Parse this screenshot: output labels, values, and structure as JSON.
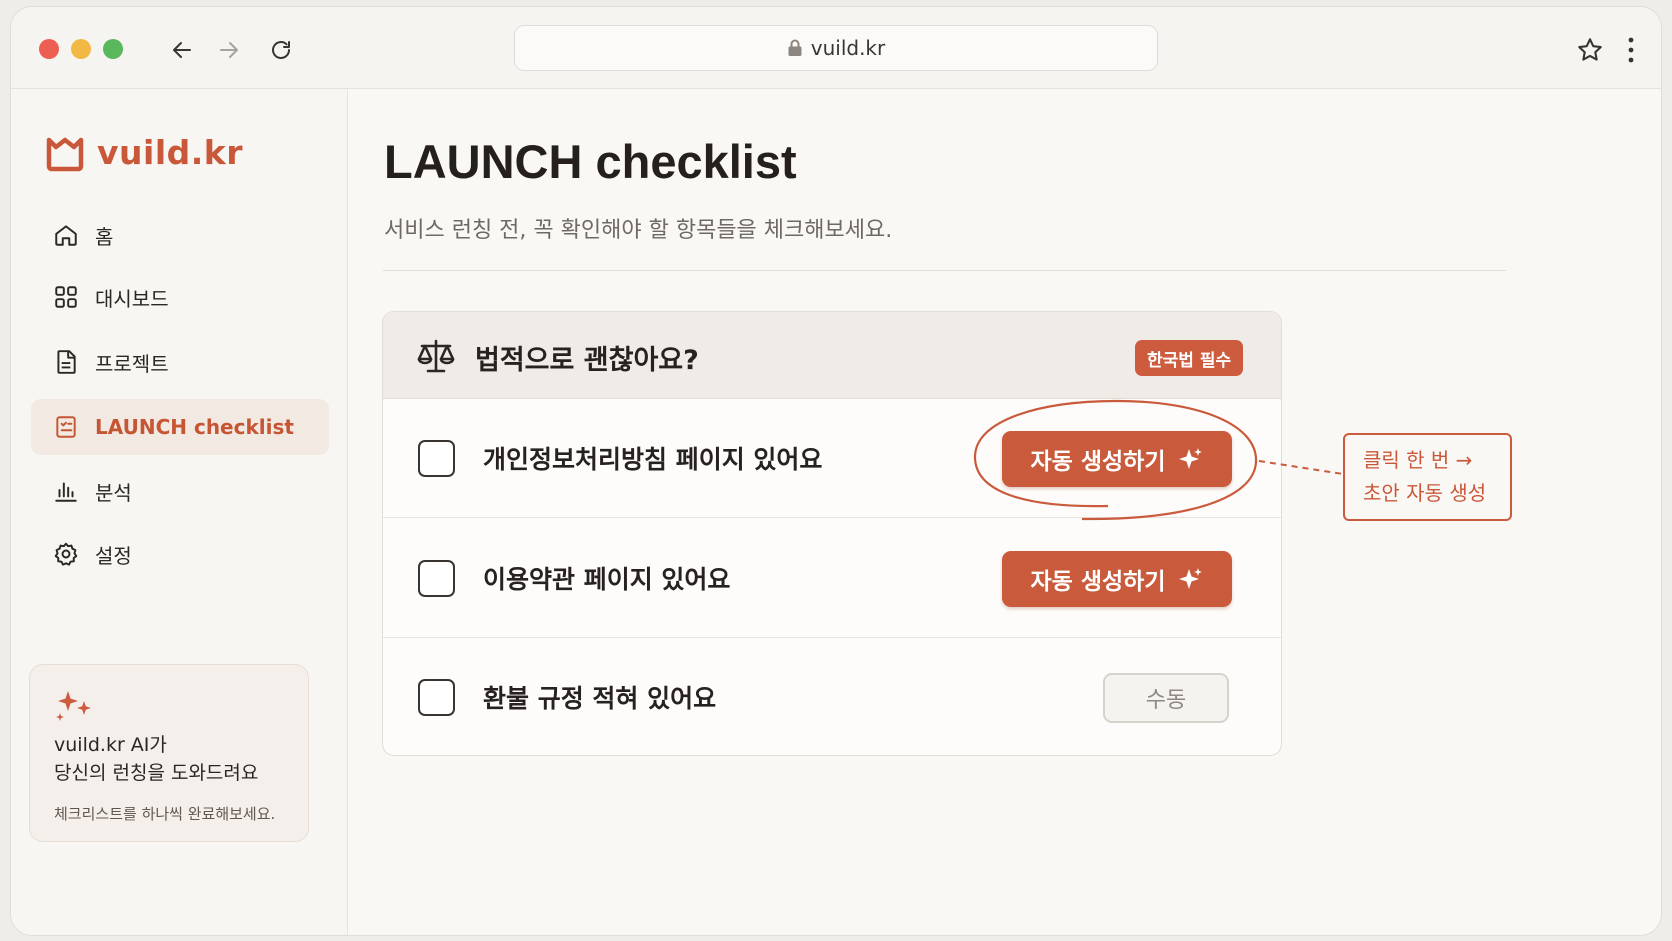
{
  "browser": {
    "url": "vuild.kr",
    "icons": [
      "back-arrow-icon",
      "forward-arrow-icon",
      "reload-icon",
      "lock-icon",
      "star-icon",
      "kebab-menu-icon"
    ]
  },
  "sidebar": {
    "logo_text": "vuild.kr",
    "items": [
      {
        "label": "홈",
        "icon": "home-icon"
      },
      {
        "label": "대시보드",
        "icon": "grid-icon"
      },
      {
        "label": "프로젝트",
        "icon": "document-icon"
      },
      {
        "label": "LAUNCH checklist",
        "icon": "checklist-icon",
        "active": true
      },
      {
        "label": "분석",
        "icon": "bar-chart-icon"
      },
      {
        "label": "설정",
        "icon": "gear-icon"
      }
    ],
    "ai_card": {
      "title_line1": "vuild.kr AI가",
      "title_line2": "당신의 런칭을 도와드려요",
      "subtitle": "체크리스트를 하나씩 완료해보세요."
    }
  },
  "main": {
    "title": "LAUNCH checklist",
    "subtitle": "서비스 런칭 전, 꼭 확인해야 할 항목들을 체크해보세요.",
    "section": {
      "title": "법적으로 괜찮아요?",
      "badge": "한국법 필수",
      "items": [
        {
          "label": "개인정보처리방침 페이지 있어요",
          "action": "자동 생성하기",
          "type": "auto"
        },
        {
          "label": "이용약관 페이지 있어요",
          "action": "자동 생성하기",
          "type": "auto"
        },
        {
          "label": "환불 규정 적혀 있어요",
          "action": "수동",
          "type": "manual"
        }
      ]
    }
  },
  "annotation": {
    "line1": "클릭 한 번 →",
    "line2": "초안 자동 생성"
  },
  "colors": {
    "accent": "#c95a3b",
    "active_bg": "#f1e9e2",
    "page_bg": "#faf8f5"
  }
}
